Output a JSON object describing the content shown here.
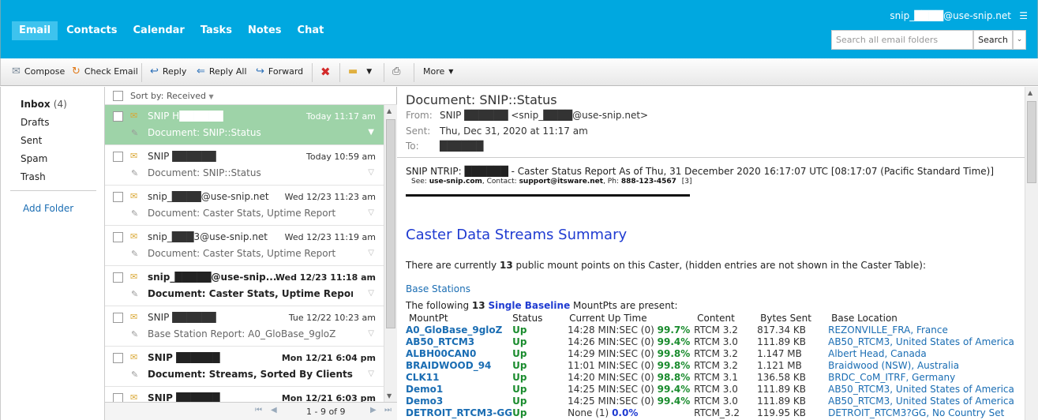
{
  "header": {
    "nav": [
      "Email",
      "Contacts",
      "Calendar",
      "Tasks",
      "Notes",
      "Chat"
    ],
    "user": "snip_████@use-snip.net",
    "menu_icon": "hamburger-icon",
    "search_placeholder": "Search all email folders",
    "search_button": "Search"
  },
  "toolbar": {
    "compose": "Compose",
    "check": "Check Email",
    "reply": "Reply",
    "reply_all": "Reply All",
    "forward": "Forward",
    "more": "More"
  },
  "folders": {
    "inbox": "Inbox",
    "inbox_count": "(4)",
    "drafts": "Drafts",
    "sent": "Sent",
    "spam": "Spam",
    "trash": "Trash",
    "add_folder": "Add Folder"
  },
  "list": {
    "sort_label": "Sort by: Received",
    "pager": "1 - 9 of 9",
    "messages": [
      {
        "from": "SNIP H██████",
        "date": "Today 11:17 am",
        "subject": "Document: SNIP::Status"
      },
      {
        "from": "SNIP ██████",
        "date": "Today 10:59 am",
        "subject": "Document: SNIP::Status"
      },
      {
        "from": "snip_████@use-snip.net",
        "date": "Wed 12/23 11:23 am",
        "subject": "Document: Caster Stats, Uptime Report"
      },
      {
        "from": "snip_███3@use-snip.net",
        "date": "Wed 12/23 11:19 am",
        "subject": "Document: Caster Stats, Uptime Report"
      },
      {
        "from": "snip_█████@use-snip....",
        "date": "Wed 12/23 11:18 am",
        "subject": "Document: Caster Stats, Uptime Report"
      },
      {
        "from": "SNIP ██████",
        "date": "Tue 12/22 10:23 am",
        "subject": "Base Station Report: A0_GloBase_9gloZ"
      },
      {
        "from": "SNIP ██████",
        "date": "Mon 12/21 6:04 pm",
        "subject": "Document: Streams, Sorted By Clients S..."
      },
      {
        "from": "SNIP ██████",
        "date": "Mon 12/21 6:03 pm",
        "subject": ""
      }
    ]
  },
  "reading": {
    "subject": "Document: SNIP::Status",
    "from_label": "From:",
    "from": "SNIP ██████ <snip_████@use-snip.net>",
    "sent_label": "Sent:",
    "sent": "Thu, Dec 31, 2020 at 11:17 am",
    "to_label": "To:",
    "to": "██████",
    "line1": "SNIP NTRIP: ██████ - Caster Status Report As of Thu, 31 December 2020 16:17:07 UTC   [08:17:07 (Pacific Standard Time)]",
    "line2_see": "See:",
    "line2_site": "use-snip.com",
    "line2_contact": ", Contact:",
    "line2_email": "support@itsware.net",
    "line2_ph": ", Ph:",
    "line2_phone": "888-123-4567",
    "line2_ref": "[3]",
    "heading": "Caster Data Streams Summary",
    "para_pre": "There are currently",
    "para_num": "13",
    "para_post": "public mount points on this Caster, (hidden entries are not shown in the Caster Table):",
    "base_stations": "Base Stations",
    "follow_pre": "The following",
    "follow_num": "13",
    "follow_link": "Single Baseline",
    "follow_post": "MountPts are present:",
    "columns": [
      "MountPt",
      "Status",
      "Current Up Time",
      "Content",
      "Bytes Sent",
      "Base Location"
    ],
    "rows": [
      {
        "mp": "A0_GloBase_9gloZ",
        "status": "Up",
        "time": "14:28 MIN:SEC (0)",
        "pct": "99.7%",
        "content": "RTCM 3.2",
        "bytes": "817.34 KB",
        "loc": "REZONVILLE_FRA, France"
      },
      {
        "mp": "AB50_RTCM3",
        "status": "Up",
        "time": "14:26 MIN:SEC (0)",
        "pct": "99.4%",
        "content": "RTCM 3.0",
        "bytes": "111.89 KB",
        "loc": "AB50_RTCM3, United States of America"
      },
      {
        "mp": "ALBH00CAN0",
        "status": "Up",
        "time": "14:29 MIN:SEC (0)",
        "pct": "99.8%",
        "content": "RTCM 3.2",
        "bytes": "1.147 MB",
        "loc": "Albert Head, Canada"
      },
      {
        "mp": "BRAIDWOOD_94",
        "status": "Up",
        "time": "11:01 MIN:SEC (0)",
        "pct": "99.8%",
        "content": "RTCM 3.2",
        "bytes": "1.121 MB",
        "loc": "Braidwood (NSW), Australia"
      },
      {
        "mp": "CLK11",
        "status": "Up",
        "time": "14:20 MIN:SEC (0)",
        "pct": "98.8%",
        "content": "RTCM 3.1",
        "bytes": "136.58 KB",
        "loc": "BRDC_CoM_ITRF, Germany"
      },
      {
        "mp": "Demo1",
        "status": "Up",
        "time": "14:25 MIN:SEC (0)",
        "pct": "99.4%",
        "content": "RTCM 3.0",
        "bytes": "111.89 KB",
        "loc": "AB50_RTCM3, United States of America"
      },
      {
        "mp": "Demo3",
        "status": "Up",
        "time": "14:25 MIN:SEC (0)",
        "pct": "99.4%",
        "content": "RTCM 3.0",
        "bytes": "111.89 KB",
        "loc": "AB50_RTCM3, United States of America"
      },
      {
        "mp": "DETROIT_RTCM3-GG",
        "status": "Up",
        "time": "None (1)",
        "pct": "0.0%",
        "content": "RTCM_3.2",
        "bytes": "119.95 KB",
        "loc": "DETROIT_RTCM3?GG, No Country Set"
      }
    ]
  }
}
